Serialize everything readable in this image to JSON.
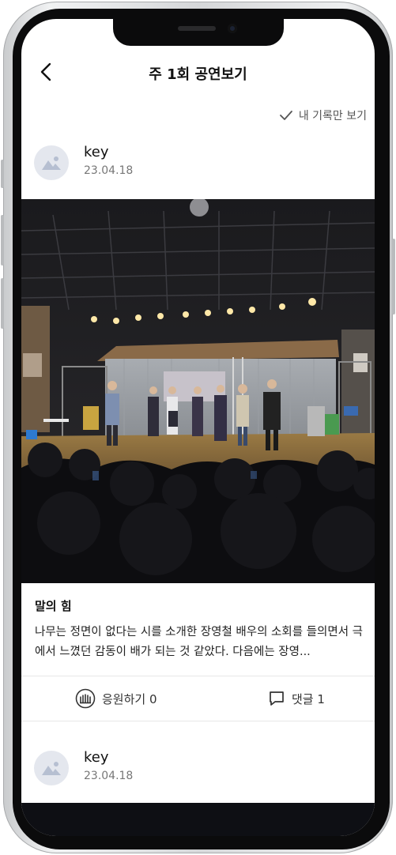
{
  "header": {
    "title": "주 1회 공연보기"
  },
  "filter": {
    "label": "내 기록만 보기"
  },
  "posts": [
    {
      "username": "key",
      "date": "23.04.18",
      "title": "말의 힘",
      "text": "나무는 정면이 없다는 시를 소개한 장영철 배우의 소회를 들의면서 극에서 느꼈던 감동이 배가 되는 것 같았다. 다음에는 장영...",
      "cheer_label": "응원하기 0",
      "comment_label": "댓글 1"
    },
    {
      "username": "key",
      "date": "23.04.18"
    }
  ],
  "icons": {
    "back": "chevron-left-icon",
    "check": "check-icon",
    "avatar": "image-placeholder-icon",
    "cheer": "audience-clap-icon",
    "comment": "speech-bubble-icon"
  }
}
